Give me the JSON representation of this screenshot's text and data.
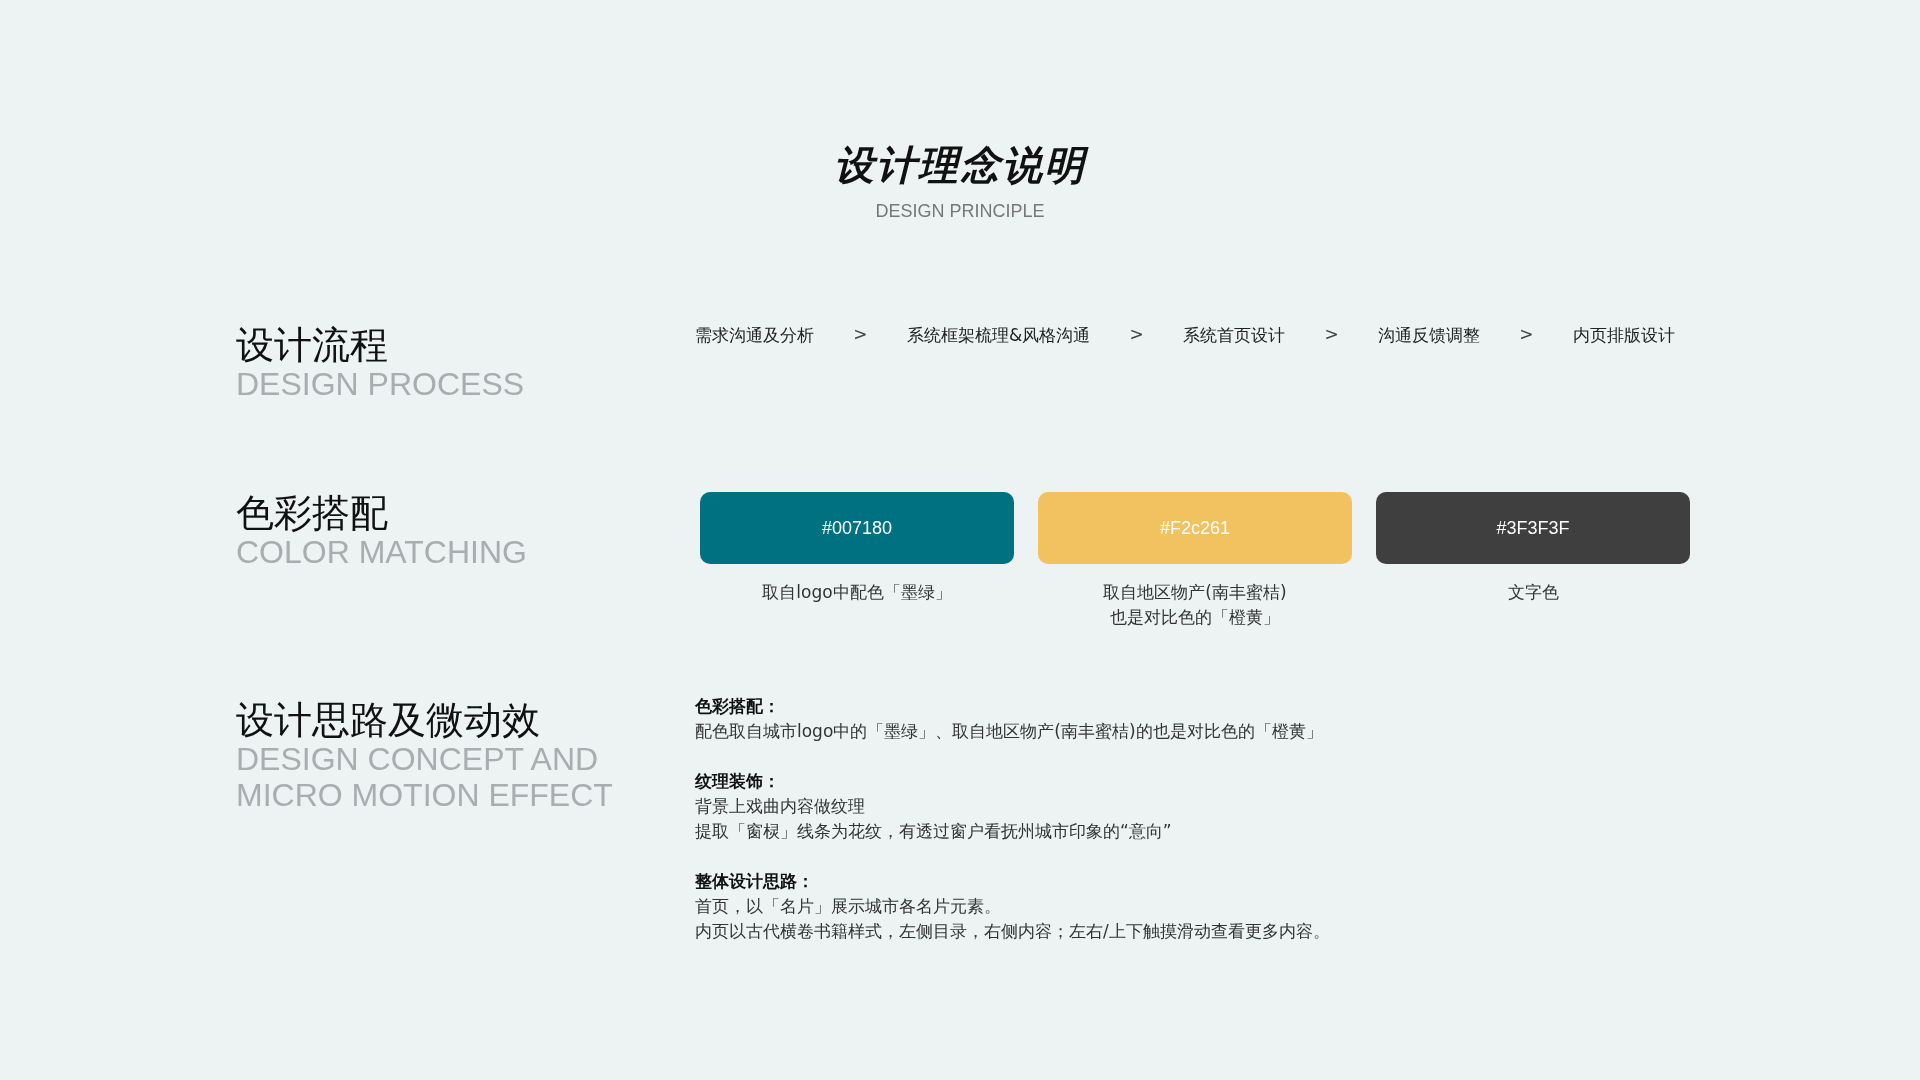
{
  "header": {
    "title": "设计理念说明",
    "subtitle": "DESIGN PRINCIPLE"
  },
  "sections": [
    {
      "kind": "process",
      "title": "设计流程",
      "subtitle_lines": [
        "DESIGN PROCESS"
      ],
      "steps": [
        {
          "label": "需求沟通及分析",
          "separator": ">"
        },
        {
          "label": "系统框架梳理&风格沟通",
          "separator": ">"
        },
        {
          "label": "系统首页设计",
          "separator": ">"
        },
        {
          "label": "沟通反馈调整",
          "separator": ">"
        },
        {
          "label": "内页排版设计"
        }
      ]
    },
    {
      "kind": "colors",
      "title": "色彩搭配",
      "subtitle_lines": [
        "COLOR MATCHING"
      ],
      "swatches": [
        {
          "label": "#007180",
          "color": "#007180",
          "caption_lines": [
            "取自logo中配色「墨绿」"
          ]
        },
        {
          "label": "#F2c261",
          "color": "#f2c261",
          "caption_lines": [
            "取自地区物产(南丰蜜桔)",
            "也是对比色的「橙黄」"
          ]
        },
        {
          "label": "#3F3F3F",
          "color": "#3f3f3f",
          "caption_lines": [
            "文字色"
          ]
        }
      ]
    },
    {
      "kind": "notes",
      "title": "设计思路及微动效",
      "subtitle_lines": [
        "DESIGN CONCEPT AND",
        "MICRO MOTION EFFECT"
      ],
      "blocks": [
        {
          "heading": "色彩搭配：",
          "lines": [
            "配色取自城市logo中的「墨绿」、取自地区物产(南丰蜜桔)的也是对比色的「橙黄」"
          ]
        },
        {
          "heading": "纹理装饰：",
          "lines": [
            "背景上戏曲内容做纹理",
            "提取「窗棂」线条为花纹，有透过窗户看抚州城市印象的“意向”"
          ]
        },
        {
          "heading": "整体设计思路：",
          "lines": [
            "首页，以「名片」展示城市各名片元素。",
            "内页以古代横卷书籍样式，左侧目录，右侧内容；左右/上下触摸滑动查看更多内容。"
          ]
        }
      ]
    }
  ]
}
